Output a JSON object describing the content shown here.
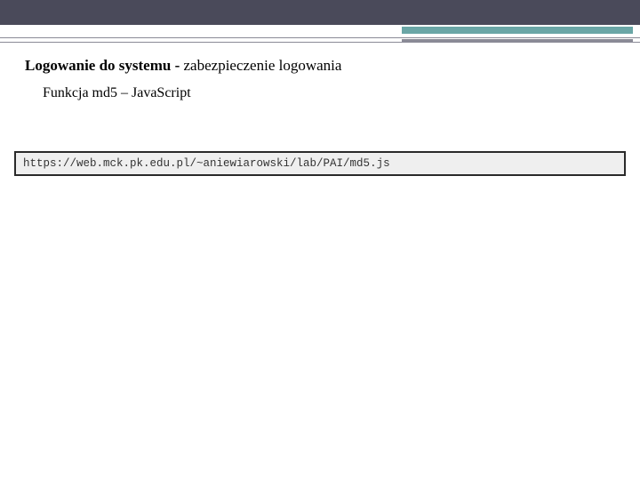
{
  "header": {
    "title_bold": "Logowanie do systemu - ",
    "title_rest": "zabezpieczenie logowania",
    "subtitle": "Funkcja md5 – JavaScript"
  },
  "code_box": {
    "text": "https://web.mck.pk.edu.pl/~aniewiarowski/lab/PAI/md5.js"
  }
}
